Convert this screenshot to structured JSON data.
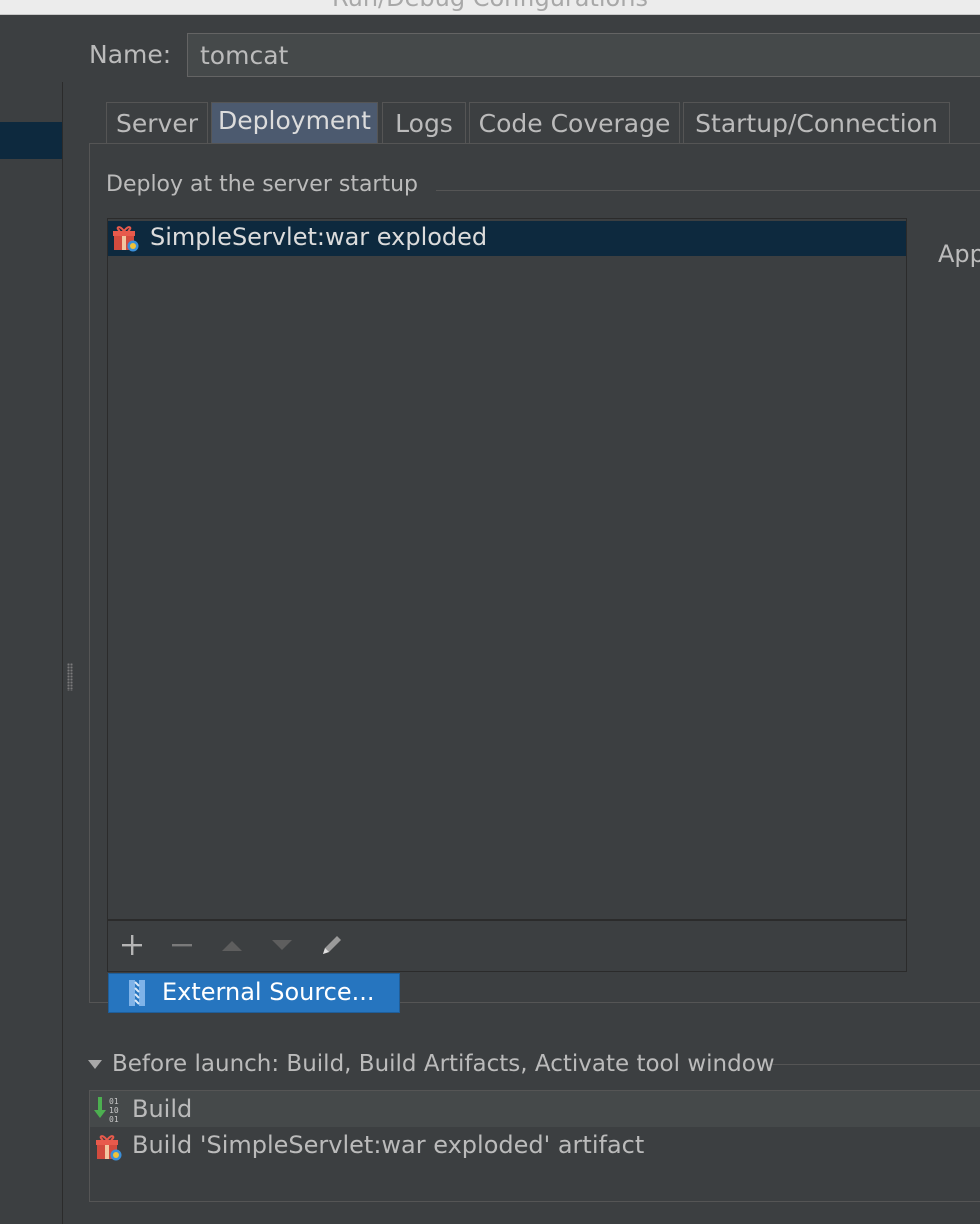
{
  "window": {
    "title": "Run/Debug Configurations"
  },
  "name_field": {
    "label": "Name:",
    "value": "tomcat"
  },
  "tabs": [
    {
      "label": "Server",
      "active": false
    },
    {
      "label": "Deployment",
      "active": true
    },
    {
      "label": "Logs",
      "active": false
    },
    {
      "label": "Code Coverage",
      "active": false
    },
    {
      "label": "Startup/Connection",
      "active": false
    }
  ],
  "deployment": {
    "section_title": "Deploy at the server startup",
    "items": [
      {
        "label": "SimpleServlet:war exploded",
        "icon": "artifact-icon",
        "selected": true
      }
    ],
    "side_label": "App",
    "toolbar": [
      {
        "name": "add-icon",
        "glyph": "+"
      },
      {
        "name": "remove-icon",
        "glyph": "−"
      },
      {
        "name": "move-up-icon",
        "glyph": "▲"
      },
      {
        "name": "move-down-icon",
        "glyph": "▼"
      },
      {
        "name": "edit-icon",
        "glyph": "✎"
      }
    ],
    "popup": {
      "label": "External Source...",
      "icon": "external-source-icon"
    }
  },
  "before_launch": {
    "title": "Before launch: Build, Build Artifacts, Activate tool window",
    "items": [
      {
        "label": "Build",
        "icon": "build-icon"
      },
      {
        "label": "Build 'SimpleServlet:war exploded' artifact",
        "icon": "artifact-icon"
      }
    ]
  },
  "colors": {
    "background": "#3c3f41",
    "selection": "#0d293e",
    "active_tab": "#4c5a6f",
    "popup_selection": "#2675bf",
    "text": "#bbbbbb"
  }
}
